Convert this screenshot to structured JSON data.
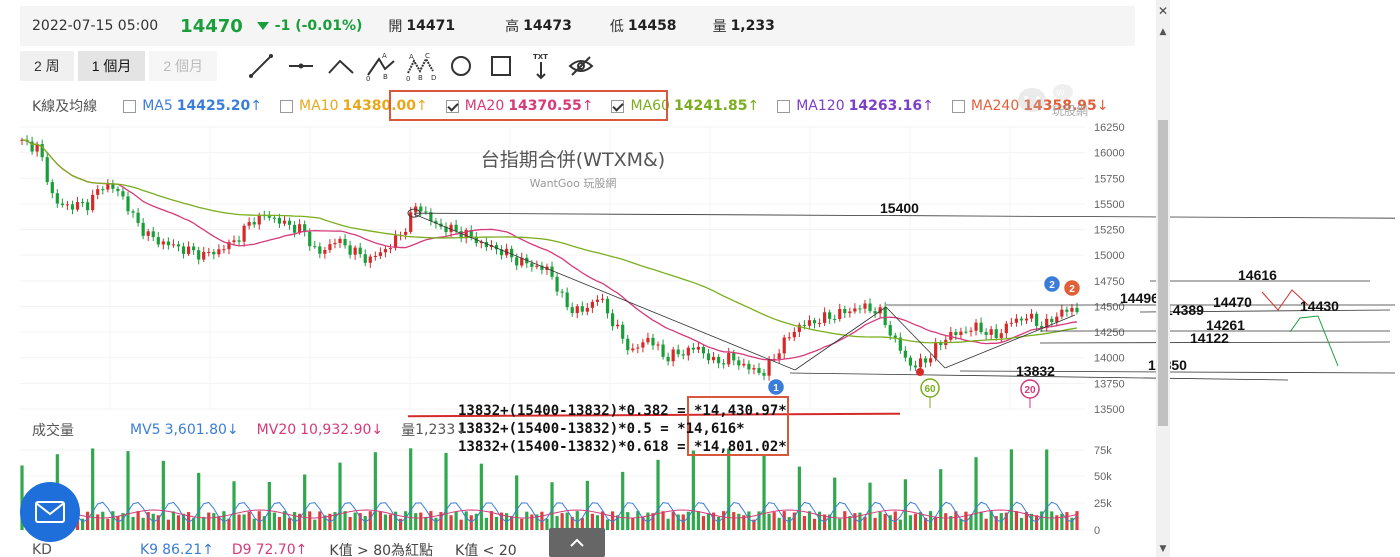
{
  "quote": {
    "date": "2022-07-15 05:00",
    "price": "14470",
    "change": "-1 (-0.01%)",
    "open_label": "開",
    "open": "14471",
    "high_label": "高",
    "high": "14473",
    "low_label": "低",
    "low": "14458",
    "vol_label": "量",
    "volume": "1,233"
  },
  "toolbar": {
    "periods": [
      {
        "label": "2 周",
        "state": "normal"
      },
      {
        "label": "1 個月",
        "state": "active"
      },
      {
        "label": "2 個月",
        "state": "disabled"
      }
    ],
    "tools": [
      "line-tool-icon",
      "horizontal-line-icon",
      "angle-line-icon",
      "abc-pattern-icon",
      "abcd-pattern-icon",
      "circle-tool-icon",
      "rectangle-tool-icon",
      "text-tool-icon",
      "hide-drawings-icon"
    ],
    "text_tool_label": "TXT"
  },
  "ma": {
    "title": "K線及均線",
    "items": [
      {
        "name": "MA5",
        "value": "14425.20",
        "arrow": "↑",
        "color": "#3b7dd8",
        "checked": false
      },
      {
        "name": "MA10",
        "value": "14380.00",
        "arrow": "↑",
        "color": "#e9a81b",
        "checked": false
      },
      {
        "name": "MA20",
        "value": "14370.55",
        "arrow": "↑",
        "color": "#d63a7a",
        "checked": true
      },
      {
        "name": "MA60",
        "value": "14241.85",
        "arrow": "↑",
        "color": "#7aae1e",
        "checked": true
      },
      {
        "name": "MA120",
        "value": "14263.16",
        "arrow": "↑",
        "color": "#7b3fc8",
        "checked": false
      },
      {
        "name": "MA240",
        "value": "14358.95",
        "arrow": "↓",
        "color": "#e0603a",
        "checked": false
      }
    ]
  },
  "chart": {
    "title": "台指期合併(WTXM&)",
    "subtitle": "WantGoo 玩股網",
    "logo_text": "玩股網",
    "y_ticks": [
      "16250",
      "16000",
      "15750",
      "15500",
      "15250",
      "15000",
      "14750",
      "14500",
      "14250",
      "14000",
      "13750",
      "13500"
    ],
    "annotations": [
      "15400",
      "14616",
      "14496",
      "14470",
      "14430",
      "14389",
      "14261",
      "14122",
      "13832",
      "13850"
    ],
    "markers": [
      "1",
      "2",
      "2",
      "60",
      "20"
    ],
    "calc_lines": [
      "13832+(15400-13832)*0.382 = *14,430.97*",
      "13832+(15400-13832)*0.5 = *14,616*",
      "13832+(15400-13832)*0.618 = *14,801.02*"
    ]
  },
  "volume": {
    "title": "成交量",
    "mv5_label": "MV5",
    "mv5": "3,601.80",
    "mv5_arrow": "↓",
    "mv20_label": "MV20",
    "mv20": "10,932.90",
    "mv20_arrow": "↓",
    "vol_label": "量",
    "vol": "1,233",
    "vol_arrow": "↓",
    "y_ticks": [
      "75k",
      "50k",
      "25k",
      "0"
    ]
  },
  "kd": {
    "title": "KD",
    "k9_label": "K9",
    "k9": "86.21",
    "k9_arrow": "↑",
    "d9_label": "D9",
    "d9": "72.70",
    "d9_arrow": "↑",
    "note1": "K值 > 80為紅點",
    "note2": "K值 < 20"
  },
  "colors": {
    "up": "#d62a2a",
    "down": "#1a9e3a",
    "ma20": "#d63a7a",
    "ma60": "#7aae1e",
    "mv5": "#3b7dd8",
    "mv20": "#d63a7a",
    "accent": "#d9573a",
    "chat": "#1e6fd9"
  },
  "chart_data": {
    "type": "candlestick",
    "y_range": [
      13500,
      16250
    ],
    "close_series_approx": [
      16100,
      16050,
      15500,
      15480,
      15500,
      15700,
      15600,
      15300,
      15150,
      15100,
      15050,
      15000,
      15050,
      15150,
      15350,
      15380,
      15300,
      15250,
      15000,
      15150,
      15050,
      14950,
      15050,
      15200,
      15500,
      15300,
      15250,
      15200,
      15100,
      15050,
      14950,
      14900,
      14850,
      14500,
      14450,
      14600,
      14300,
      14050,
      14200,
      14000,
      14050,
      14100,
      13950,
      14000,
      13900,
      13850,
      14100,
      14300,
      14350,
      14400,
      14450,
      14500,
      14450,
      14150,
      13900,
      14000,
      14200,
      14250,
      14300,
      14200,
      14350,
      14400,
      14300,
      14450,
      14470
    ],
    "fib_levels": [
      14430.97,
      14616,
      14801.02
    ],
    "swing_high": 15400,
    "swing_low": 13832
  }
}
